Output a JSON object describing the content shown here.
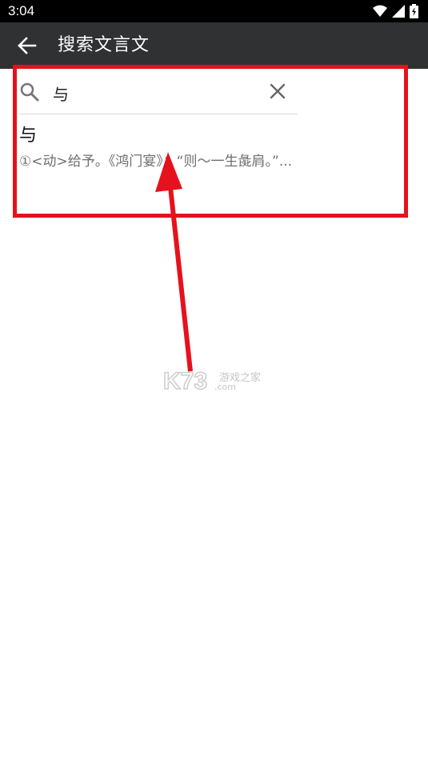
{
  "status_bar": {
    "time": "3:04",
    "icons": [
      "wifi-icon",
      "signal-icon",
      "battery-icon"
    ]
  },
  "app_bar": {
    "back_icon": "arrow-left-icon",
    "title": "搜索文言文"
  },
  "search": {
    "icon": "search-icon",
    "value": "与",
    "clear_icon": "close-icon"
  },
  "results": [
    {
      "title": "与",
      "description": "①<动>给予。《鸿门宴》：“则～一生彘肩。”..."
    }
  ],
  "annotation": {
    "highlight_color": "#e5121d",
    "arrow_color": "#e5121d"
  },
  "watermark": {
    "logo": "K73",
    "text": "游戏之家",
    "domain": ".com"
  },
  "colors": {
    "status_bar": "#000000",
    "app_bar": "#2f3133",
    "background": "#ffffff",
    "secondary_text": "#6f6f6f"
  }
}
